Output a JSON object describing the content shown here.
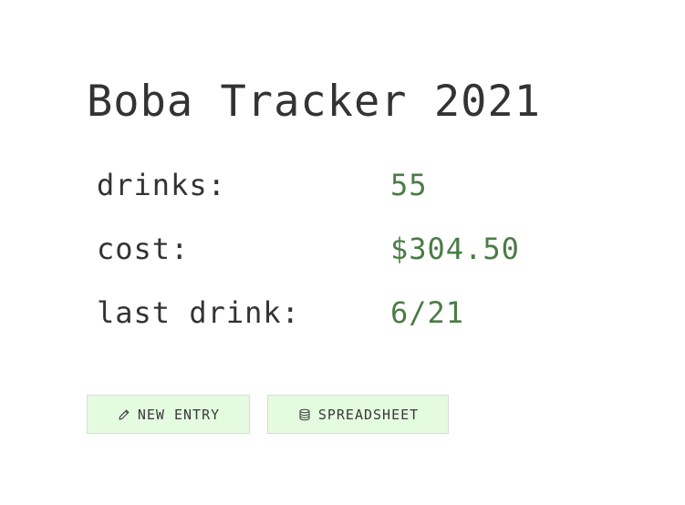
{
  "title": "Boba Tracker 2021",
  "stats": {
    "drinks": {
      "label": "drinks:",
      "value": "55"
    },
    "cost": {
      "label": "cost:",
      "value": "$304.50"
    },
    "last_drink": {
      "label": "last drink:",
      "value": "6/21"
    }
  },
  "actions": {
    "new_entry": {
      "label": "NEW ENTRY",
      "icon": "pencil-icon"
    },
    "spreadsheet": {
      "label": "SPREADSHEET",
      "icon": "database-icon"
    }
  },
  "colors": {
    "value_green": "#4a7c45",
    "button_bg": "#e4fbe0",
    "text_dark": "#333333"
  }
}
